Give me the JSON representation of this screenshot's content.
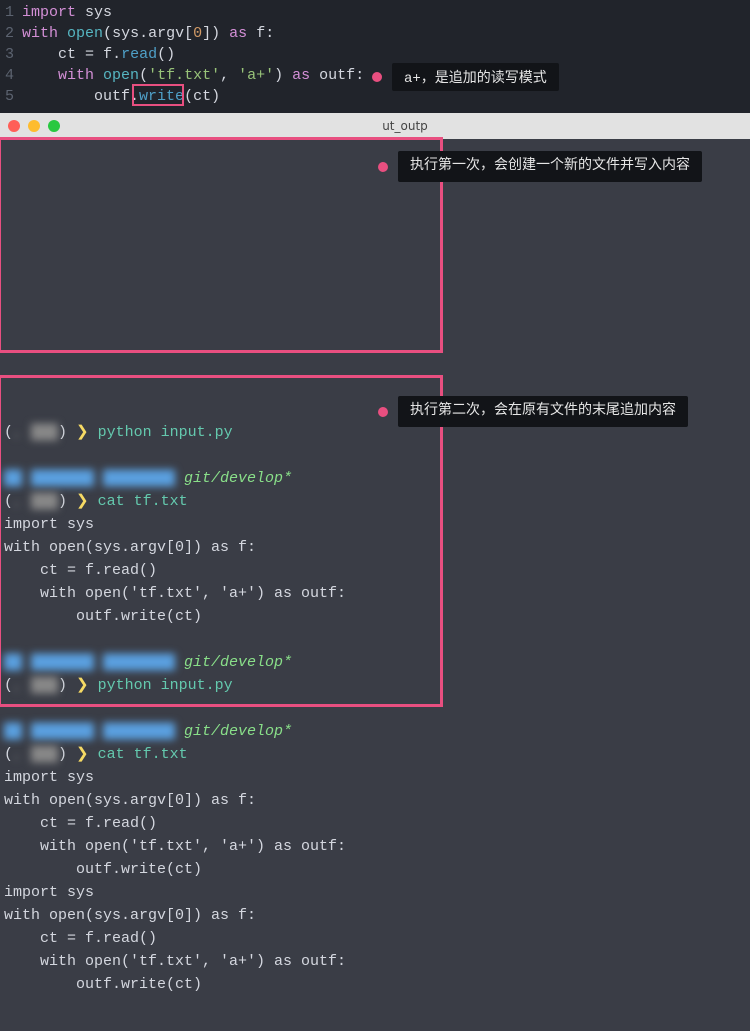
{
  "editor": {
    "lines": [
      {
        "n": "1",
        "tokens": [
          [
            "kw-import",
            "import"
          ],
          [
            "white",
            " "
          ],
          [
            "id",
            "sys"
          ]
        ]
      },
      {
        "n": "2",
        "tokens": [
          [
            "kw-with",
            "with"
          ],
          [
            "white",
            " "
          ],
          [
            "fn",
            "open"
          ],
          [
            "punct",
            "("
          ],
          [
            "id",
            "sys"
          ],
          [
            "punct",
            "."
          ],
          [
            "id",
            "argv"
          ],
          [
            "punct",
            "["
          ],
          [
            "num",
            "0"
          ],
          [
            "punct",
            "]) "
          ],
          [
            "kw-as",
            "as"
          ],
          [
            "white",
            " "
          ],
          [
            "id",
            "f"
          ],
          [
            "punct",
            ":"
          ]
        ]
      },
      {
        "n": "3",
        "tokens": [
          [
            "white",
            "    "
          ],
          [
            "id",
            "ct"
          ],
          [
            "white",
            " "
          ],
          [
            "punct",
            "="
          ],
          [
            "white",
            " "
          ],
          [
            "id",
            "f"
          ],
          [
            "punct",
            "."
          ],
          [
            "method",
            "read"
          ],
          [
            "punct",
            "()"
          ]
        ]
      },
      {
        "n": "4",
        "tokens": [
          [
            "white",
            "    "
          ],
          [
            "kw-with",
            "with"
          ],
          [
            "white",
            " "
          ],
          [
            "fn",
            "open"
          ],
          [
            "punct",
            "("
          ],
          [
            "str",
            "'tf.txt'"
          ],
          [
            "punct",
            ", "
          ],
          [
            "str",
            "'a+'"
          ],
          [
            "punct",
            ") "
          ],
          [
            "kw-as",
            "as"
          ],
          [
            "white",
            " "
          ],
          [
            "id",
            "outf"
          ],
          [
            "punct",
            ":"
          ]
        ]
      },
      {
        "n": "5",
        "tokens": [
          [
            "white",
            "        "
          ],
          [
            "id",
            "outf"
          ],
          [
            "punct",
            "."
          ],
          [
            "method",
            "write"
          ],
          [
            "punct",
            "("
          ],
          [
            "id",
            "ct"
          ],
          [
            "punct",
            ")"
          ]
        ]
      }
    ],
    "highlight_write": "write",
    "annotation1": "a+，是追加的读写模式"
  },
  "titlebar": {
    "text": "ut_outp"
  },
  "terminal": {
    "annotation2": "执行第一次，会创建一个新的文件并写入内容",
    "annotation3": "执行第二次，会在原有文件的末尾追加内容",
    "prompt_arrow": "❯",
    "cmd_python": "python input.py",
    "cmd_cat": "cat tf.txt",
    "git": "git/develop*",
    "output_block": [
      "import sys",
      "with open(sys.argv[0]) as f:",
      "    ct = f.read()",
      "    with open('tf.txt', 'a+') as outf:",
      "        outf.write(ct)"
    ]
  }
}
